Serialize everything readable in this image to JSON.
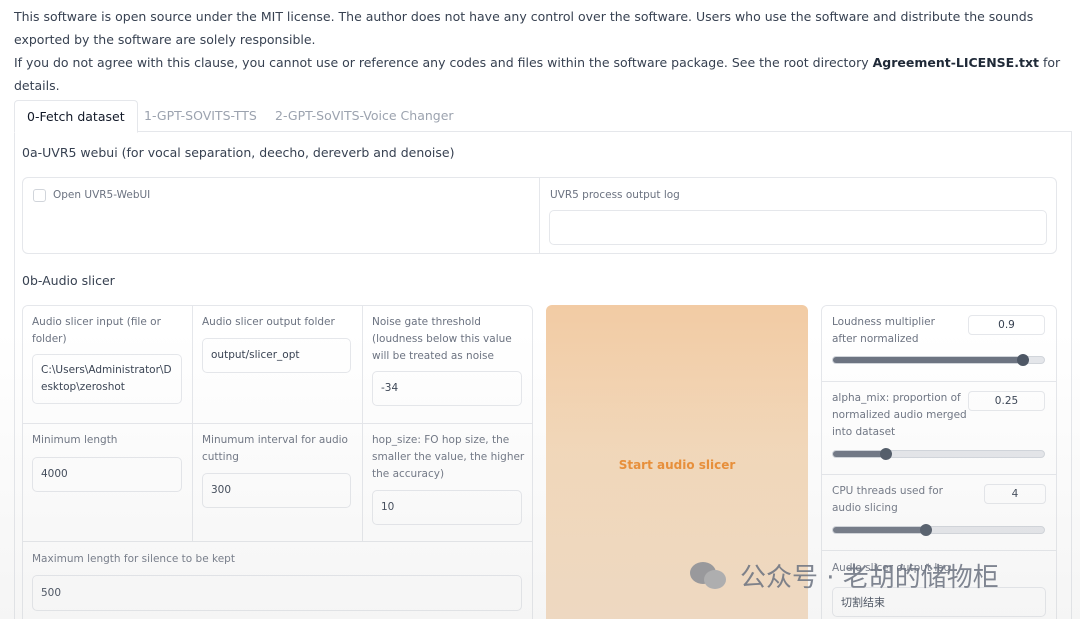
{
  "notice": {
    "line1": "This software is open source under the MIT license. The author does not have any control over the software. Users who use the software and distribute the sounds exported by the software are solely responsible.",
    "line2_pre": "If you do not agree with this clause, you cannot use or reference any codes and files within the software package. See the root directory ",
    "line2_bold": "Agreement-LICENSE.txt",
    "line2_post": " for details."
  },
  "tabs": [
    {
      "label": "0-Fetch dataset"
    },
    {
      "label": "1-GPT-SOVITS-TTS"
    },
    {
      "label": "2-GPT-SoVITS-Voice Changer"
    }
  ],
  "uvr5": {
    "title": "0a-UVR5 webui (for vocal separation, deecho, dereverb and denoise)",
    "checkbox_label": "Open UVR5-WebUI",
    "log_label": "UVR5 process output log",
    "log_value": ""
  },
  "slicer": {
    "title": "0b-Audio slicer",
    "input_label": "Audio slicer input (file or folder)",
    "input_value": "C:\\Users\\Administrator\\Desktop\\zeroshot",
    "output_label": "Audio slicer output folder",
    "output_value": "output/slicer_opt",
    "threshold_label": "Noise gate threshold (loudness below this value will be treated as noise",
    "threshold_value": "-34",
    "min_length_label": "Minimum length",
    "min_length_value": "4000",
    "min_interval_label": "Minumum interval for audio cutting",
    "min_interval_value": "300",
    "hop_label": "hop_size: FO hop size, the smaller the value, the higher the accuracy)",
    "hop_value": "10",
    "max_silence_label": "Maximum length for silence to be kept",
    "max_silence_value": "500",
    "start_button": "Start audio slicer",
    "loudness_label": "Loudness multiplier after normalized",
    "loudness_value": "0.9",
    "loudness_fraction": 0.9,
    "alpha_label": "alpha_mix: proportion of normalized audio merged into dataset",
    "alpha_value": "0.25",
    "alpha_fraction": 0.25,
    "threads_label": "CPU threads used for audio slicing",
    "threads_value": "4",
    "threads_fraction": 0.44,
    "log_label": "Audio slicer output log",
    "log_value": "切割结束"
  },
  "watermark": {
    "text": "公众号 · 老胡的储物柜",
    "icon": "wechat-icon"
  }
}
